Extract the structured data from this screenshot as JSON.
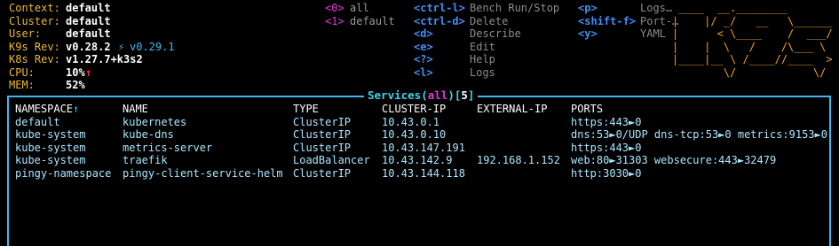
{
  "info": [
    {
      "key": "Context:",
      "value": "default"
    },
    {
      "key": "Cluster:",
      "value": "default"
    },
    {
      "key": "User:",
      "value": "default"
    },
    {
      "key": "K9s Rev:",
      "value": "v0.28.2",
      "upgrade": "v0.29.1"
    },
    {
      "key": "K8s Rev:",
      "value": "v1.27.7+k3s2"
    },
    {
      "key": "CPU:",
      "value": "10%"
    },
    {
      "key": "MEM:",
      "value": "52%"
    }
  ],
  "namespaces": [
    {
      "key": "<0>",
      "label": "all"
    },
    {
      "key": "<1>",
      "label": "default"
    }
  ],
  "hotkeys_col1": [
    {
      "key": "<ctrl-l>",
      "label": "Bench Run/Stop"
    },
    {
      "key": "<ctrl-d>",
      "label": "Delete"
    },
    {
      "key": "<d>",
      "label": "Describe"
    },
    {
      "key": "<e>",
      "label": "Edit"
    },
    {
      "key": "<?>",
      "label": "Help"
    },
    {
      "key": "<l>",
      "label": "Logs"
    }
  ],
  "hotkeys_col2": [
    {
      "key": "<p>",
      "label": "Logs…"
    },
    {
      "key": "<shift-f>",
      "label": "Port-…"
    },
    {
      "key": "<y>",
      "label": "YAML"
    }
  ],
  "logo": [
    " ____  __.________       ",
    "|    |/ _/   __   \\______",
    "|      < \\____    /  ___/",
    "|    |  \\   /    /\\___ \\ ",
    "|____|__ \\ /____//____  >",
    "        \\/            \\/ "
  ],
  "frame": {
    "resource": "Services",
    "filter": "all",
    "count": "5"
  },
  "table": {
    "columns": [
      "NAMESPACE",
      "NAME",
      "TYPE",
      "CLUSTER-IP",
      "EXTERNAL-IP",
      "PORTS"
    ],
    "sort_indicator": "↑",
    "rows": [
      [
        "default",
        "kubernetes",
        "ClusterIP",
        "10.43.0.1",
        "",
        "https:443►0"
      ],
      [
        "kube-system",
        "kube-dns",
        "ClusterIP",
        "10.43.0.10",
        "",
        "dns:53►0/UDP dns-tcp:53►0 metrics:9153►0"
      ],
      [
        "kube-system",
        "metrics-server",
        "ClusterIP",
        "10.43.147.191",
        "",
        "https:443►0"
      ],
      [
        "kube-system",
        "traefik",
        "LoadBalancer",
        "10.43.142.9",
        "192.168.1.152",
        "web:80►31303 websecure:443►32479"
      ],
      [
        "pingy-namespace",
        "pingy-client-service-helm",
        "ClusterIP",
        "10.43.144.118",
        "",
        "http:3030►0"
      ]
    ]
  }
}
